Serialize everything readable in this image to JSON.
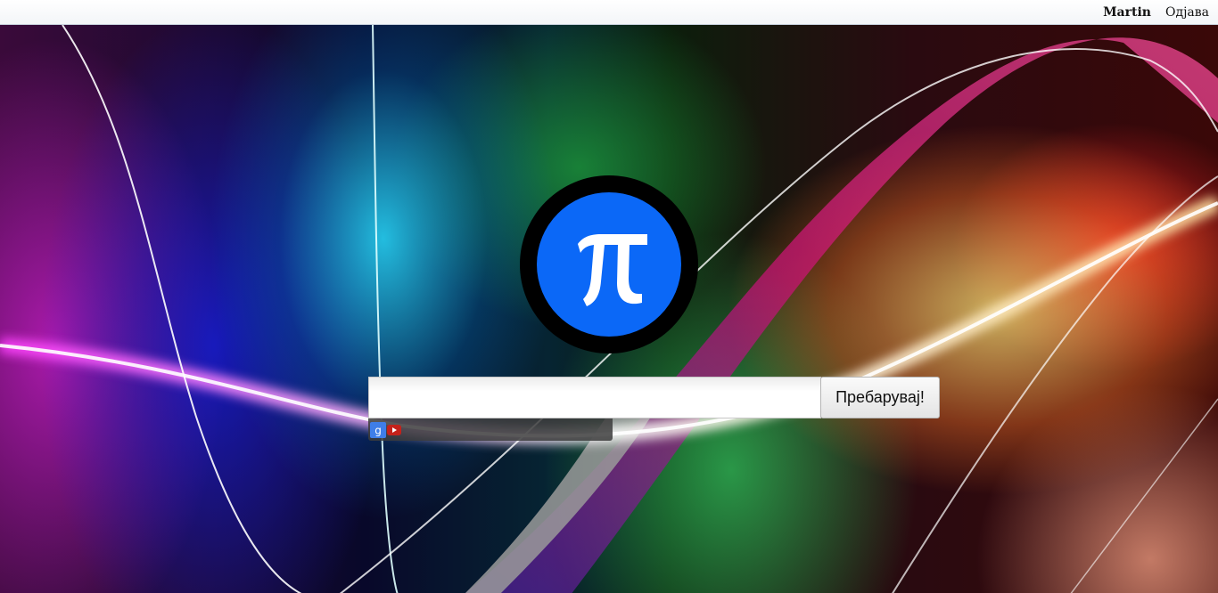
{
  "topbar": {
    "user_name": "Martin",
    "logout_label": "Одјава"
  },
  "logo": {
    "symbol": "π",
    "circle_color": "#0b68f7",
    "ring_color": "#000000"
  },
  "search": {
    "value": "",
    "placeholder": "",
    "button_label": "Пребарувај!"
  },
  "engines": [
    {
      "name": "google",
      "icon": "google-icon",
      "glyph": "g",
      "color": "#2f6fd6"
    },
    {
      "name": "youtube",
      "icon": "youtube-icon",
      "glyph": "▶",
      "color": "#c4221b"
    }
  ]
}
